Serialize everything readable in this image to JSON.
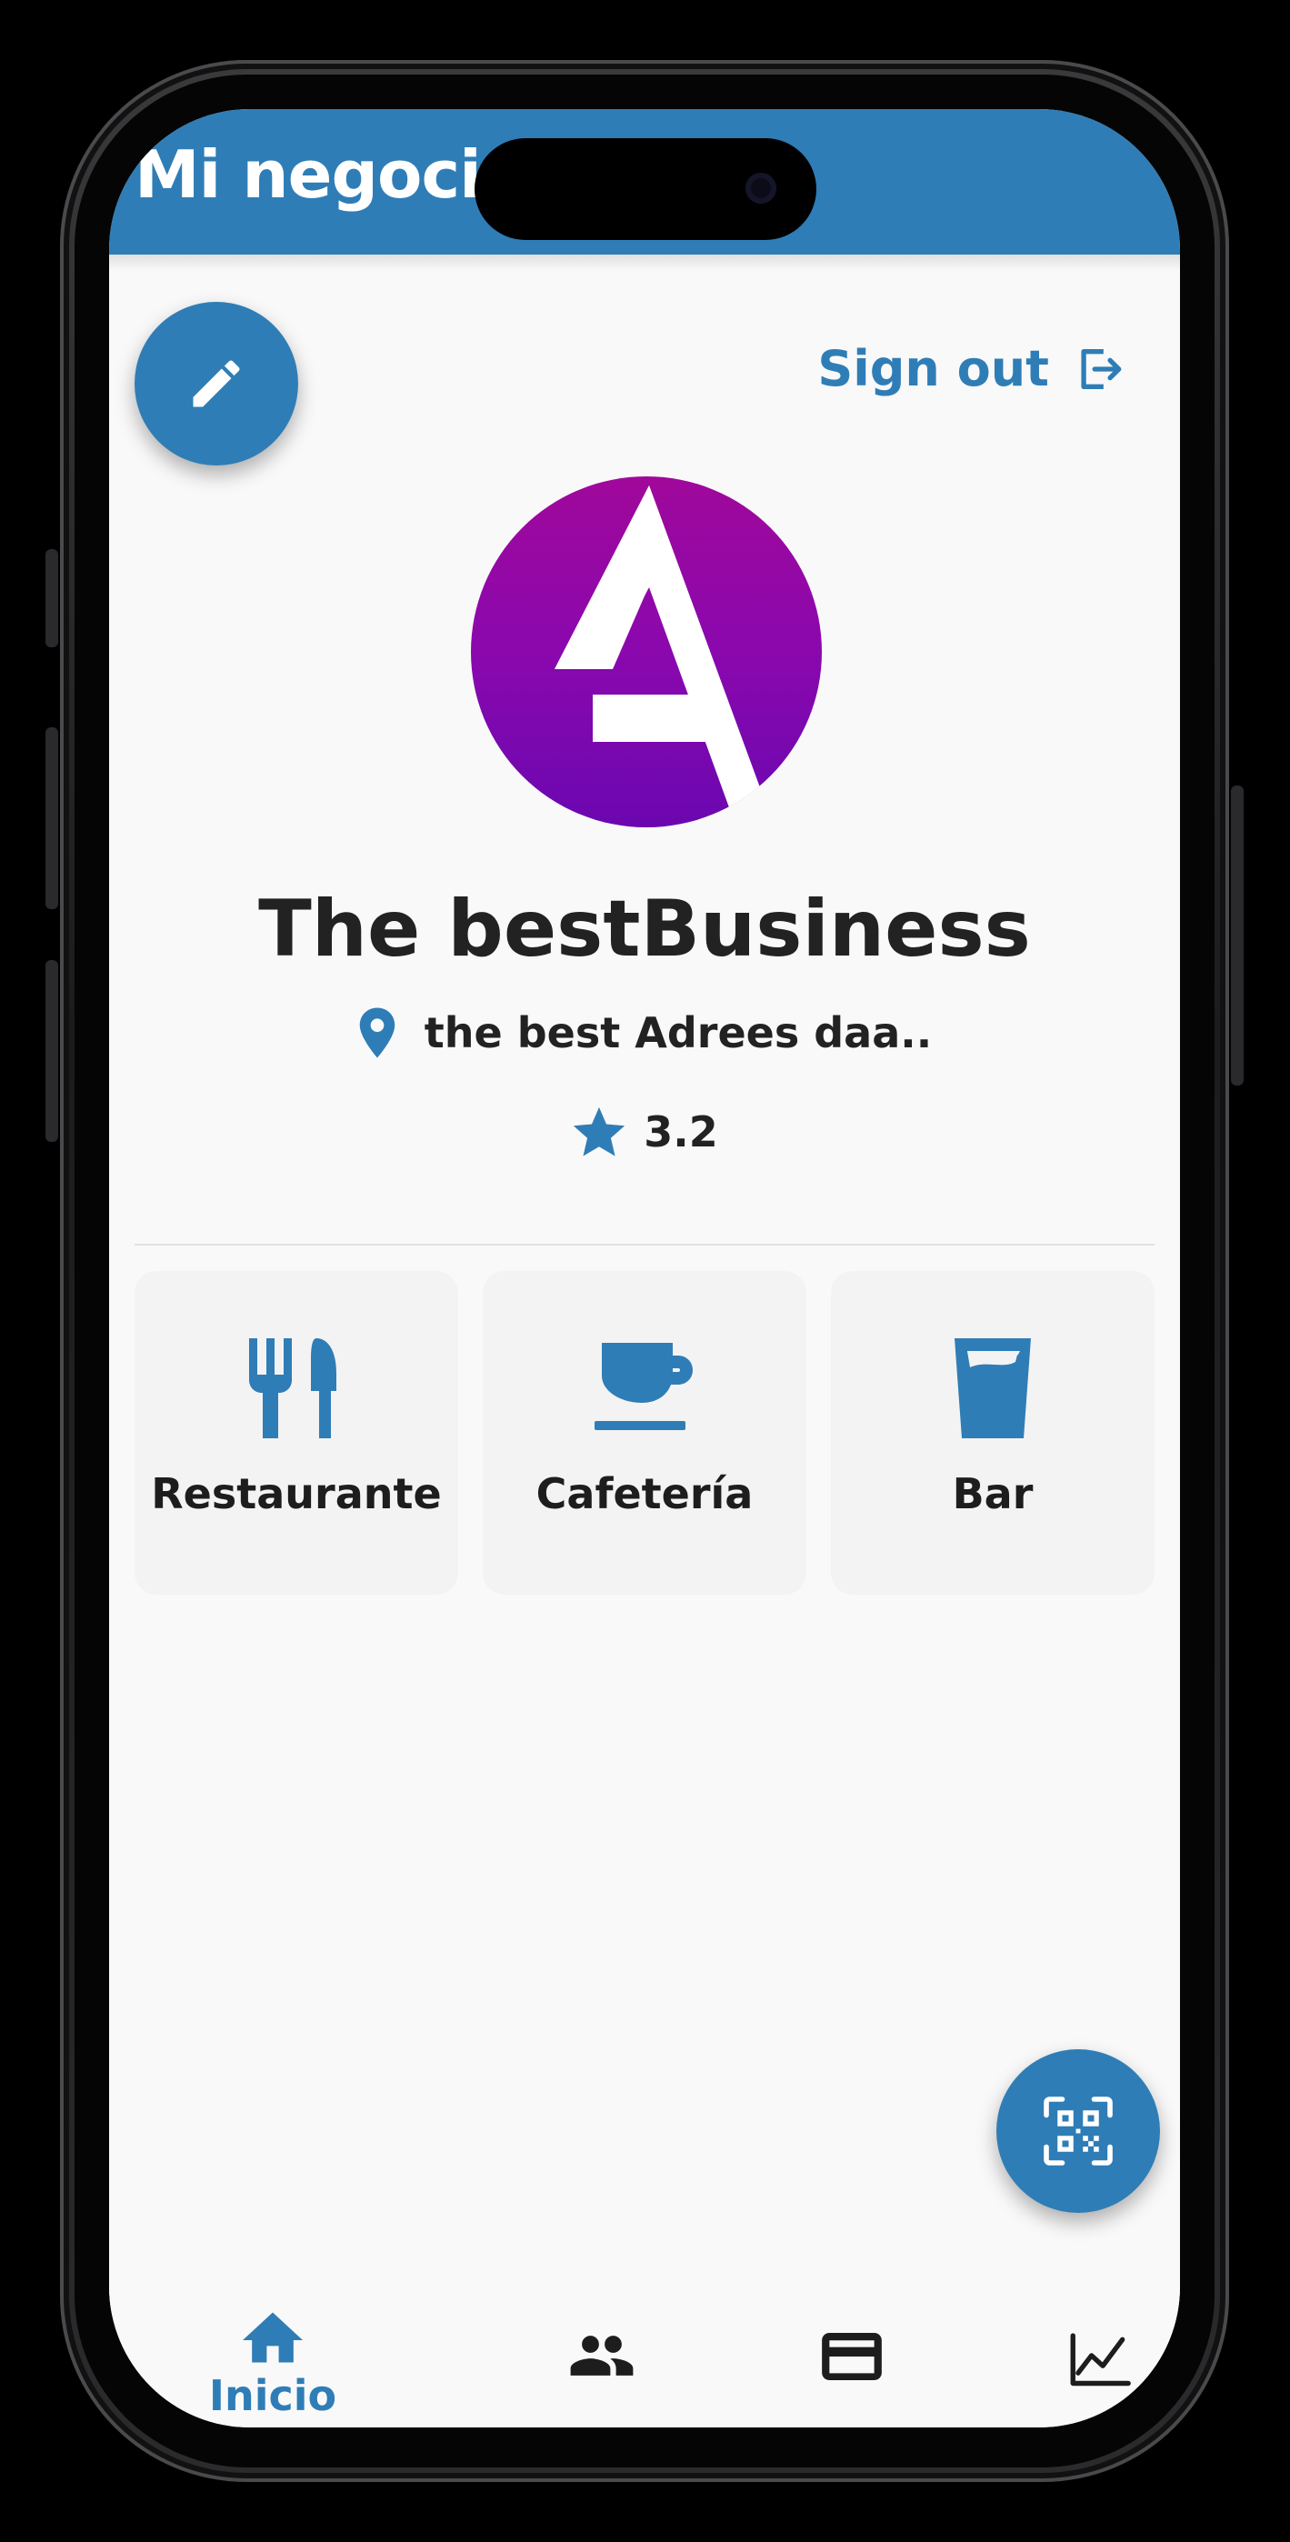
{
  "app_bar": {
    "title": "Mi negocio",
    "background": "#2f7db6"
  },
  "actions": {
    "edit_icon": "pencil-icon",
    "sign_out_label": "Sign out",
    "sign_out_icon": "logout-icon",
    "qr_icon": "qr-scan-icon"
  },
  "business": {
    "name": "The bestBusiness",
    "address": "the best Adrees daa..",
    "rating": "3.2",
    "logo_letter": "A",
    "logo_colors": [
      "#a0089a",
      "#6b07b0"
    ]
  },
  "categories": [
    {
      "label": "Restaurante",
      "icon": "fork-knife-icon"
    },
    {
      "label": "Cafetería",
      "icon": "coffee-cup-icon"
    },
    {
      "label": "Bar",
      "icon": "drink-glass-icon"
    }
  ],
  "bottom_nav": {
    "items": [
      {
        "label": "Inicio",
        "icon": "home-icon",
        "active": true
      },
      {
        "label": "",
        "icon": "people-icon",
        "active": false
      },
      {
        "label": "",
        "icon": "credit-card-icon",
        "active": false
      },
      {
        "label": "",
        "icon": "chart-line-icon",
        "active": false
      }
    ]
  },
  "colors": {
    "accent": "#2f7db6",
    "text": "#222222",
    "card": "#f3f3f3",
    "screen_bg": "#f9f9f9"
  }
}
